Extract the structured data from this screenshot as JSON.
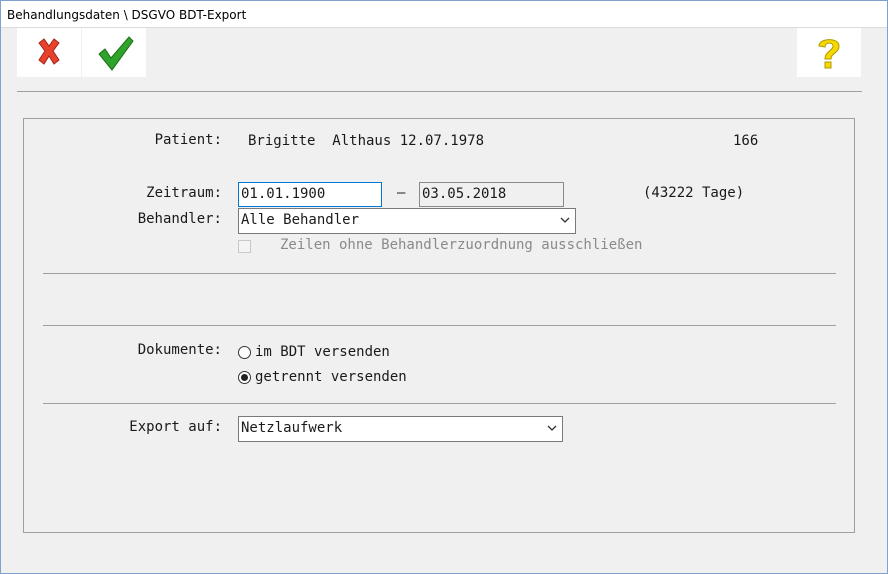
{
  "window": {
    "title": "Behandlungsdaten \\ DSGVO BDT-Export"
  },
  "toolbar": {
    "cancel_icon": "red-x-icon",
    "ok_icon": "green-checkmark-icon",
    "help_icon": "yellow-question-icon"
  },
  "patient": {
    "label": "Patient:",
    "name": "Brigitte  Althaus 12.07.1978",
    "number": "166"
  },
  "zeitraum": {
    "label": "Zeitraum:",
    "from": "01.01.1900",
    "dash": "–",
    "to": "03.05.2018",
    "days": "(43222 Tage)"
  },
  "behandler": {
    "label": "Behandler:",
    "selected": "Alle Behandler",
    "checkbox_label": "Zeilen ohne Behandlerzuordnung ausschließen",
    "checkbox_checked": false
  },
  "dokumente": {
    "label": "Dokumente:",
    "options": [
      {
        "label": "im BDT versenden",
        "selected": false
      },
      {
        "label": "getrennt versenden",
        "selected": true
      }
    ]
  },
  "export": {
    "label": "Export auf:",
    "selected": "Netzlaufwerk"
  },
  "colors": {
    "cancel": "#e8412c",
    "ok": "#2fa32a",
    "help": "#f5d800",
    "focus_border": "#0078d7"
  }
}
